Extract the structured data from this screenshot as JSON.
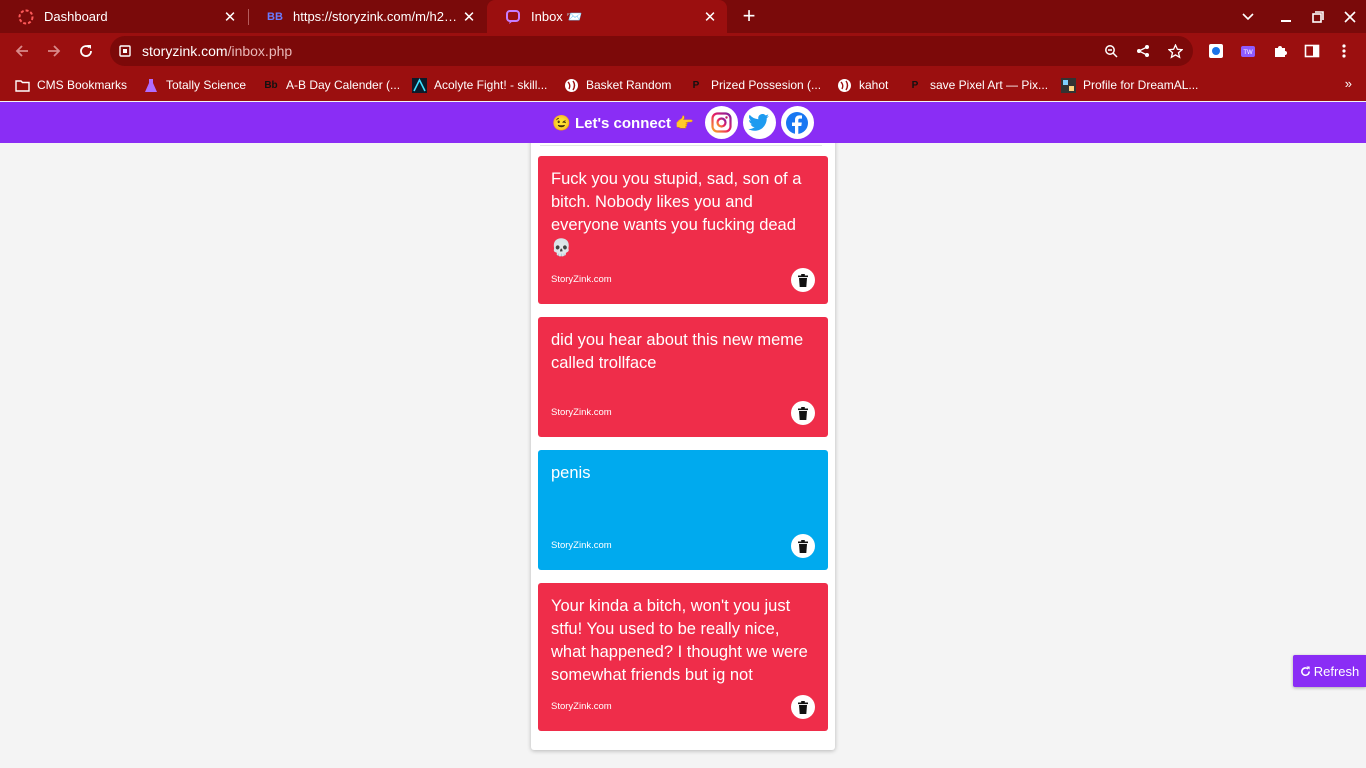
{
  "browser": {
    "tabs": [
      {
        "title": "Dashboard",
        "icon": "dashboard-icon",
        "active": false
      },
      {
        "title": "https://storyzink.com/m/h2098",
        "icon": "bb-icon",
        "active": false
      },
      {
        "title": "Inbox 📨",
        "icon": "storyzink-icon",
        "active": true
      }
    ],
    "url": {
      "host": "storyzink.com",
      "path": "/inbox.php"
    },
    "bookmarks": [
      {
        "label": "CMS Bookmarks",
        "icon": "folder-icon"
      },
      {
        "label": "Totally Science",
        "icon": "flask-icon"
      },
      {
        "label": "A-B Day Calender (...",
        "icon": "bb-icon"
      },
      {
        "label": "Acolyte Fight! - skill...",
        "icon": "acolyte-icon"
      },
      {
        "label": "Basket Random",
        "icon": "globe-icon"
      },
      {
        "label": "Prized Possesion (...",
        "icon": "p-icon"
      },
      {
        "label": "kahot",
        "icon": "globe-icon"
      },
      {
        "label": "save Pixel Art — Pix...",
        "icon": "p-icon"
      },
      {
        "label": "Profile for DreamAL...",
        "icon": "profile-icon"
      }
    ],
    "theme": {
      "frame": "#7a0a0a",
      "toolbar": "#9b0f0f",
      "omnibox": "#7c0909"
    }
  },
  "page": {
    "connect_text": "😉 Let's connect 👉",
    "social": [
      "instagram-icon",
      "twitter-icon",
      "facebook-icon"
    ],
    "messages": [
      {
        "text": "Fuck you you stupid, sad, son of a bitch. Nobody likes you and everyone wants you fucking dead 💀",
        "brand": "StoryZink.com",
        "color": "#ef2d4a"
      },
      {
        "text": "did you hear about this new meme called trollface",
        "brand": "StoryZink.com",
        "color": "#ef2d4a"
      },
      {
        "text": "penis",
        "brand": "StoryZink.com",
        "color": "#00aaee"
      },
      {
        "text": "Your kinda a bitch, won't you just stfu! You used to be really nice, what happened? I thought we were somewhat friends but ig not",
        "brand": "StoryZink.com",
        "color": "#ef2d4a"
      }
    ],
    "refresh_label": "Refresh",
    "accent": "#8a2df5"
  }
}
